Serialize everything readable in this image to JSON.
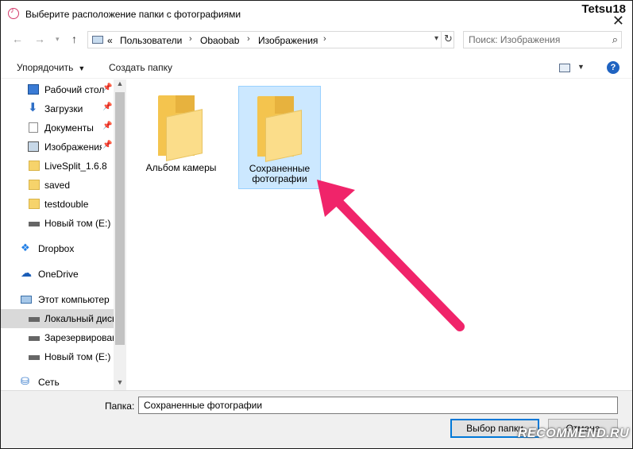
{
  "window": {
    "title": "Выберите расположение папки с фотографиями",
    "watermark_user": "Tetsu18",
    "close_glyph": "✕"
  },
  "address": {
    "prefix": "«",
    "crumbs": [
      "Пользователи",
      "Obaobab",
      "Изображения"
    ],
    "separator": "›"
  },
  "search": {
    "placeholder": "Поиск: Изображения"
  },
  "toolbar": {
    "organize_label": "Упорядочить",
    "new_folder_label": "Создать папку",
    "help_label": "?"
  },
  "sidebar": {
    "items": [
      {
        "label": "Рабочий стол",
        "icon": "desktop-icon",
        "pinned": true
      },
      {
        "label": "Загрузки",
        "icon": "download-icon",
        "pinned": true
      },
      {
        "label": "Документы",
        "icon": "documents-icon",
        "pinned": true
      },
      {
        "label": "Изображения",
        "icon": "pictures-icon",
        "pinned": true
      },
      {
        "label": "LiveSplit_1.6.8",
        "icon": "folder-icon"
      },
      {
        "label": "saved",
        "icon": "folder-icon"
      },
      {
        "label": "testdouble",
        "icon": "folder-icon"
      },
      {
        "label": "Новый том (E:)",
        "icon": "drive-icon"
      },
      {
        "label": "Dropbox",
        "icon": "dropbox-icon"
      },
      {
        "label": "OneDrive",
        "icon": "onedrive-icon"
      },
      {
        "label": "Этот компьютер",
        "icon": "computer-icon"
      },
      {
        "label": "Локальный диск",
        "icon": "drive-icon",
        "selected": true
      },
      {
        "label": "Зарезервировано",
        "icon": "drive-icon"
      },
      {
        "label": "Новый том (E:)",
        "icon": "drive-icon"
      },
      {
        "label": "Сеть",
        "icon": "network-icon"
      }
    ]
  },
  "folders": [
    {
      "label": "Альбом камеры",
      "selected": false
    },
    {
      "label": "Сохраненные фотографии",
      "selected": true
    }
  ],
  "bottom": {
    "folder_label": "Папка:",
    "folder_value": "Сохраненные фотографии",
    "select_button": "Выбор папки",
    "cancel_button": "Отмена"
  },
  "watermark": "RECOMMEND.RU",
  "colors": {
    "accent": "#0078d7",
    "selection": "#cce8ff",
    "arrow": "#f0246a"
  }
}
